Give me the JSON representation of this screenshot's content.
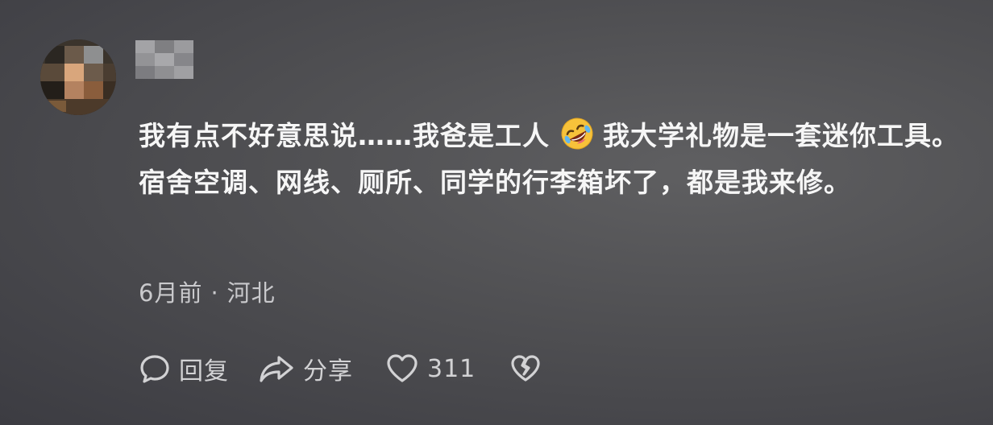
{
  "comment": {
    "text": {
      "part1": "我有点不好意思说……我爸是工人",
      "emoji": "rolling-on-floor-laughing-emoji",
      "part2": "我大学礼物是一套迷你工具。宿舍空调、网线、厕所、同学的行李箱坏了，都是我来修。"
    },
    "meta": {
      "time": "6月前",
      "separator": "·",
      "location": "河北"
    },
    "actions": {
      "reply_label": "回复",
      "share_label": "分享",
      "like_count": "311"
    },
    "icons": {
      "reply": "speech-bubble-icon",
      "share": "share-arrow-icon",
      "like": "heart-icon",
      "dislike": "broken-heart-icon"
    }
  },
  "colors": {
    "text_primary": "#f6f6f6",
    "text_secondary": "#c9c9cc",
    "emoji_yellow": "#f7c23a"
  }
}
